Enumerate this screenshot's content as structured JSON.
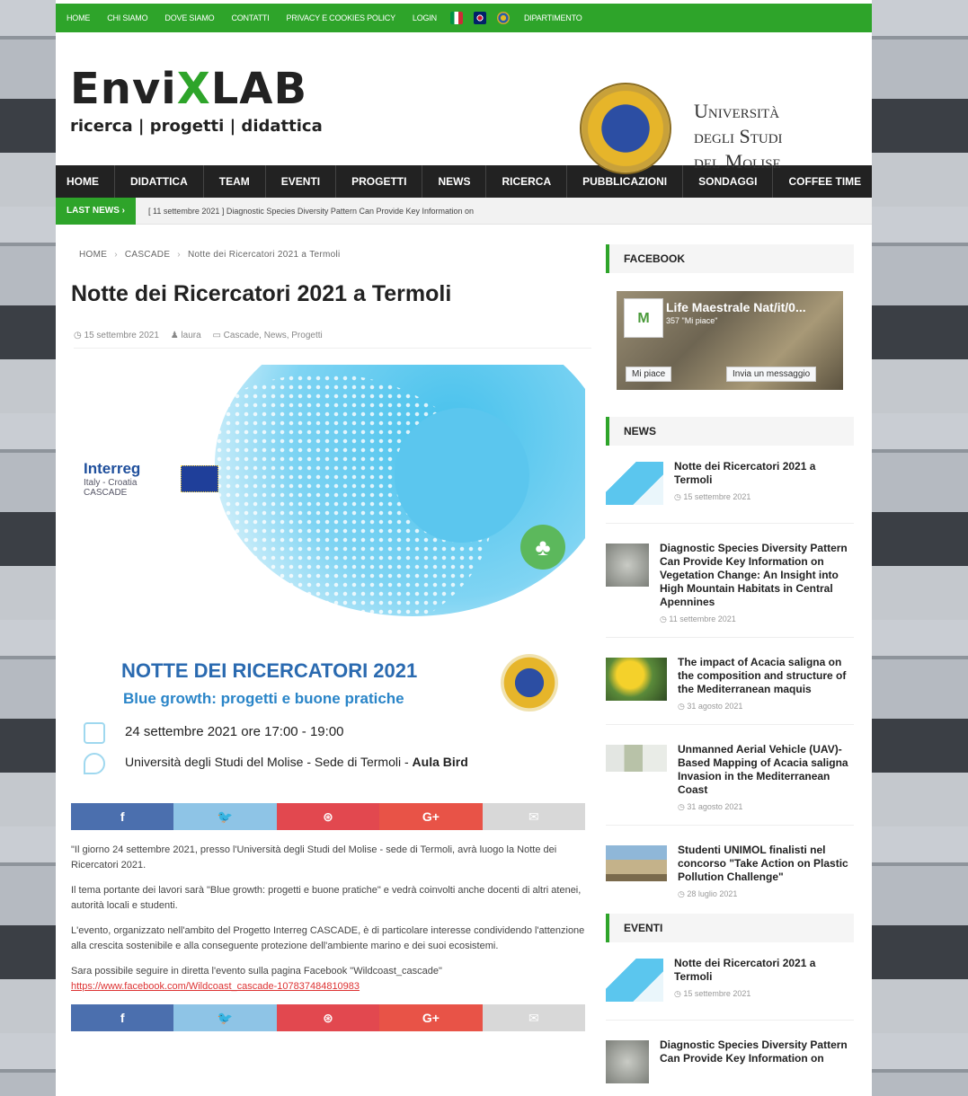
{
  "topbar": {
    "links": [
      "HOME",
      "CHI SIAMO",
      "DOVE SIAMO",
      "CONTATTI",
      "PRIVACY E COOKIES POLICY",
      "LOGIN"
    ],
    "dept": "DIPARTIMENTO",
    "color": "#2ea42a"
  },
  "header": {
    "logo_pre": "Envi",
    "logo_x": "X",
    "logo_post": "LAB",
    "tagline": "ricerca | progetti | didattica",
    "uni_line1": "Università",
    "uni_line2": "degli Studi",
    "uni_line3": "del Molise"
  },
  "nav": [
    "HOME",
    "DIDATTICA",
    "TEAM",
    "EVENTI",
    "PROGETTI",
    "NEWS",
    "RICERCA",
    "PUBBLICAZIONI",
    "SONDAGGI",
    "COFFEE TIME"
  ],
  "ticker": {
    "label": "LAST NEWS ›",
    "text": "[ 11 settembre 2021 ]  Diagnostic Species Diversity Pattern Can Provide Key Information on"
  },
  "breadcrumb": {
    "home": "HOME",
    "cat": "CASCADE",
    "page": "Notte dei Ricercatori 2021 a Termoli"
  },
  "post": {
    "title": "Notte dei Ricercatori 2021 a Termoli",
    "date": "◷ 15 settembre 2021",
    "author": "♟ laura",
    "cats": "▭ Cascade, News, Progetti",
    "hero": {
      "brand": "Interreg",
      "brand_sub": "Italy - Croatia",
      "brand_sub2": "CASCADE",
      "h1": "NOTTE DEI RICERCATORI 2021",
      "h2": "Blue growth: progetti e buone pratiche",
      "date": "24 settembre 2021 ore 17:00 - 19:00",
      "place": "Università degli Studi del Molise - Sede di Termoli - ",
      "place_bold": "Aula Bird"
    },
    "paragraphs": [
      "\"Il giorno 24 settembre 2021, presso l'Università degli Studi del Molise - sede di Termoli, avrà luogo la Notte dei Ricercatori 2021.",
      "Il tema portante dei lavori sarà \"Blue growth: progetti e buone pratiche\" e vedrà coinvolti anche docenti di altri atenei, autorità locali e studenti.",
      "L'evento, organizzato nell'ambito del Progetto Interreg CASCADE, è di particolare interesse condividendo l'attenzione alla crescita sostenibile e alla conseguente protezione dell'ambiente marino e dei suoi ecosistemi."
    ],
    "last_para": "Sara possibile seguire in diretta l'evento sulla pagina Facebook \"Wildcoast_cascade\" ",
    "link": "https://www.facebook.com/Wildcoast_cascade-107837484810983"
  },
  "share": {
    "fb": "f",
    "tw": "🐦",
    "pi": "⊛",
    "gp": "G+",
    "ml": "✉"
  },
  "sidebar": {
    "facebook_title": "FACEBOOK",
    "fb": {
      "name": "Life Maestrale Nat/it/0...",
      "likes": "357 \"Mi piace\"",
      "like_btn": "Mi piace",
      "msg_btn": "Invia un messaggio",
      "avatar": "M"
    },
    "news_title": "NEWS",
    "news": [
      {
        "title": "Notte dei Ricercatori 2021 a Termoli",
        "date": "◷ 15 settembre 2021"
      },
      {
        "title": "Diagnostic Species Diversity Pattern Can Provide Key Information on Vegetation Change: An Insight into High Mountain Habitats in Central Apennines",
        "date": "◷ 11 settembre 2021"
      },
      {
        "title": "The impact of Acacia saligna on the composition and structure of the Mediterranean maquis",
        "date": "◷ 31 agosto 2021"
      },
      {
        "title": "Unmanned Aerial Vehicle (UAV)-Based Mapping of Acacia saligna Invasion in the Mediterranean Coast",
        "date": "◷ 31 agosto 2021"
      },
      {
        "title": "Studenti UNIMOL finalisti nel concorso \"Take Action on Plastic Pollution Challenge\"",
        "date": "◷ 28 luglio 2021"
      }
    ],
    "events_title": "EVENTI",
    "events": [
      {
        "title": "Notte dei Ricercatori 2021 a Termoli",
        "date": "◷ 15 settembre 2021"
      },
      {
        "title": "Diagnostic Species Diversity Pattern Can Provide Key Information on",
        "date": ""
      }
    ]
  }
}
